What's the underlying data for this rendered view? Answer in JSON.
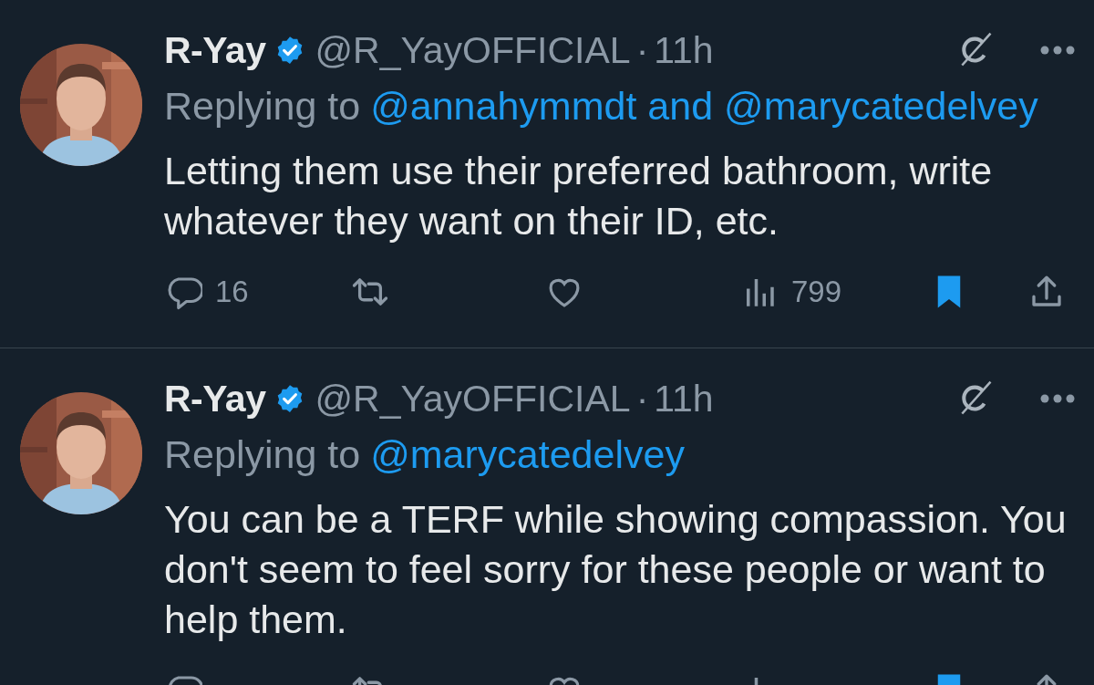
{
  "tweets": [
    {
      "author": {
        "name": "R-Yay",
        "verified": true,
        "handle": "@R_YayOFFICIAL",
        "separator": "·",
        "time": "11h"
      },
      "replying_to": {
        "label": "Replying to",
        "mentions": "@annahymmdt and @marycatedelvey"
      },
      "text": "Letting them use their preferred bathroom, write whatever they want on their ID, etc.",
      "actions": [
        {
          "kind": "reply",
          "count": "16"
        },
        {
          "kind": "repost"
        },
        {
          "kind": "like",
          "liked": false
        },
        {
          "kind": "views",
          "count": "799"
        },
        {
          "kind": "bookmark",
          "bookmarked": true
        },
        {
          "kind": "share"
        }
      ]
    },
    {
      "author": {
        "name": "R-Yay",
        "verified": true,
        "handle": "@R_YayOFFICIAL",
        "separator": "·",
        "time": "11h"
      },
      "replying_to": {
        "label": "Replying to",
        "mentions": "@marycatedelvey"
      },
      "text": "You can be a TERF while showing compassion. You don't seem to feel sorry for these people or want to help them.",
      "actions": [
        {
          "kind": "reply"
        },
        {
          "kind": "repost"
        },
        {
          "kind": "like",
          "liked": false
        },
        {
          "kind": "views"
        },
        {
          "kind": "bookmark",
          "bookmarked": true
        },
        {
          "kind": "share"
        }
      ]
    }
  ]
}
